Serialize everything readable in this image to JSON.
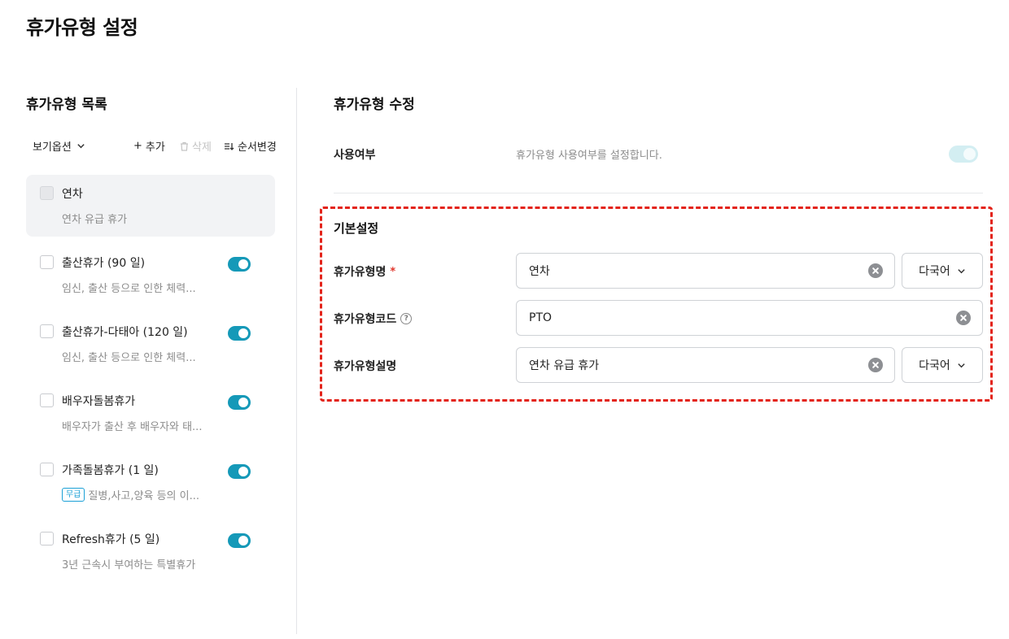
{
  "page": {
    "title": "휴가유형 설정"
  },
  "list": {
    "title": "휴가유형 목록",
    "toolbar": {
      "view_options": "보기옵션",
      "add": "추가",
      "delete": "삭제",
      "reorder": "순서변경"
    },
    "items": [
      {
        "name": "연차",
        "description": "연차 유급 휴가",
        "selected": true,
        "enabled": null,
        "badge": ""
      },
      {
        "name": "출산휴가 (90 일)",
        "description": "임신, 출산 등으로 인한 체력...",
        "selected": false,
        "enabled": true,
        "badge": ""
      },
      {
        "name": "출산휴가-다태아 (120 일)",
        "description": "임신, 출산 등으로 인한 체력...",
        "selected": false,
        "enabled": true,
        "badge": ""
      },
      {
        "name": "배우자돌봄휴가",
        "description": "배우자가 출산 후 배우자와 태...",
        "selected": false,
        "enabled": true,
        "badge": ""
      },
      {
        "name": "가족돌봄휴가 (1 일)",
        "description": "질병,사고,양육 등의 이...",
        "selected": false,
        "enabled": true,
        "badge": "무급"
      },
      {
        "name": "Refresh휴가 (5 일)",
        "description": "3년 근속시 부여하는 특별휴가",
        "selected": false,
        "enabled": true,
        "badge": ""
      }
    ]
  },
  "edit": {
    "title": "휴가유형 수정",
    "usage": {
      "label": "사용여부",
      "description": "휴가유형 사용여부를 설정합니다.",
      "enabled": true
    },
    "basic": {
      "title": "기본설정",
      "name": {
        "label": "휴가유형명",
        "required_mark": "*",
        "value": "연차",
        "lang_label": "다국어"
      },
      "code": {
        "label": "휴가유형코드",
        "help_icon": "?",
        "value": "PTO"
      },
      "description": {
        "label": "휴가유형설명",
        "value": "연차 유급 휴가",
        "lang_label": "다국어"
      }
    }
  },
  "colors": {
    "accent": "#1599b8",
    "highlight_border": "#e3241b",
    "muted_text": "#8c8c8c"
  }
}
